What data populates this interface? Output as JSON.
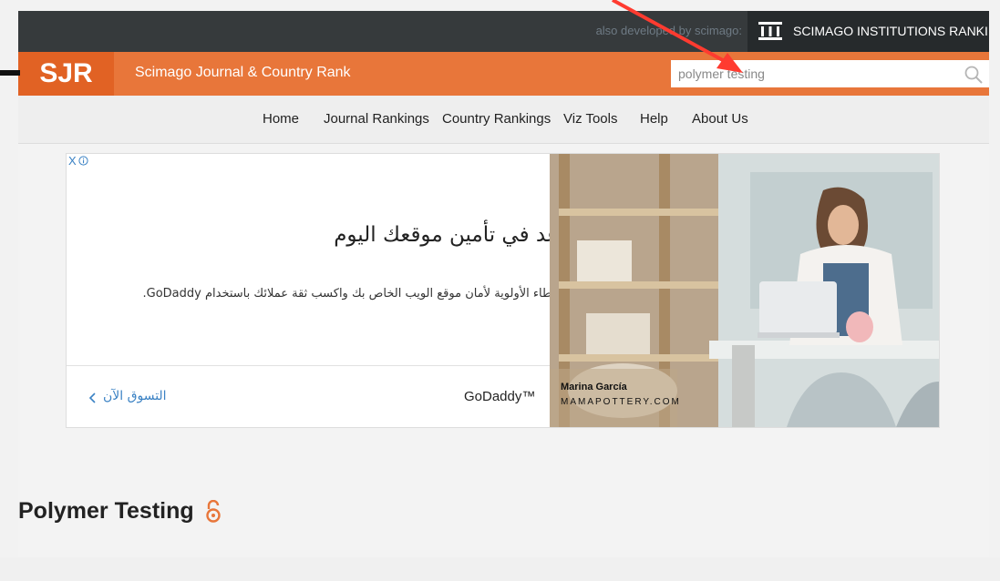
{
  "topbar": {
    "developed_by": "also developed by scimago:",
    "institutions_label": "SCIMAGO INSTITUTIONS RANKINGS",
    "institutions_icon": "columns-building-icon"
  },
  "header": {
    "logo": "SJR",
    "site_title": "Scimago Journal & Country Rank",
    "search_value": "polymer testing",
    "search_icon": "search-icon"
  },
  "nav": {
    "items": [
      {
        "label": "Home"
      },
      {
        "label": "Journal Rankings"
      },
      {
        "label": "Country Rankings"
      },
      {
        "label": "Viz Tools"
      },
      {
        "label": "Help"
      },
      {
        "label": "About Us"
      }
    ]
  },
  "ad": {
    "close_label": "X",
    "headline": "ساعد في تأمين موقعك اليوم",
    "subtext": "قم بإعطاء الأولوية لأمان موقع الويب الخاص بك واكسب ثقة عملائك باستخدام GoDaddy.",
    "brand": "GoDaddy™",
    "cta": "التسوق الآن",
    "caption_name": "Marina García",
    "caption_site": "MAMAPOTTERY.COM"
  },
  "journal": {
    "title": "Polymer Testing",
    "open_access_icon": "open-access-icon"
  },
  "colors": {
    "topbar": "#363a3c",
    "orange": "#e8763a",
    "logo_bg": "#e16224",
    "annotation_arrow": "#ff3b30"
  }
}
